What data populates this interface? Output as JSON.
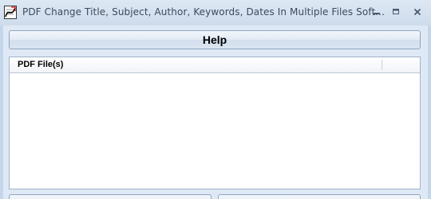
{
  "window": {
    "title": "PDF Change Title, Subject, Author, Keywords, Dates In Multiple Files Soft..."
  },
  "titlebar_buttons": {
    "minimize_icon": "minimize-icon",
    "maximize_icon": "maximize-icon",
    "close_icon": "close-icon"
  },
  "toolbar": {
    "help_label": "Help"
  },
  "file_list": {
    "columns": [
      "PDF File(s)",
      ""
    ],
    "rows": []
  },
  "colors": {
    "window_frame": "#c4d6ea",
    "client_background": "#dfe9f5",
    "list_background": "#ffffff"
  }
}
